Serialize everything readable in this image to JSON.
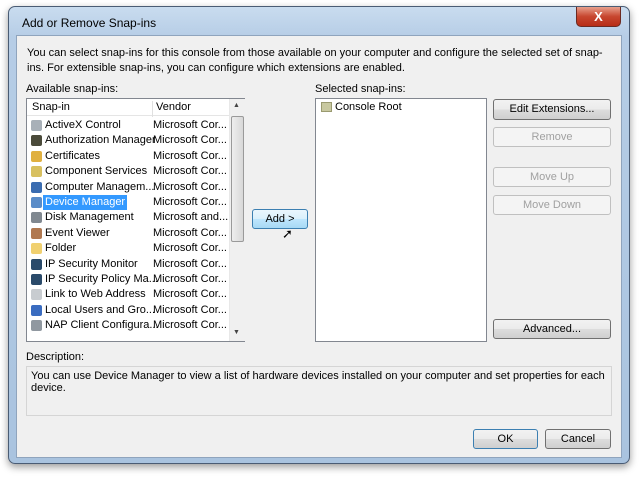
{
  "window": {
    "title": "Add or Remove Snap-ins",
    "close_label": "X"
  },
  "intro": "You can select snap-ins for this console from those available on your computer and configure the selected set of snap-ins. For extensible snap-ins, you can configure which extensions are enabled.",
  "available": {
    "label": "Available snap-ins:",
    "col_snapin": "Snap-in",
    "col_vendor": "Vendor",
    "items": [
      {
        "name": "ActiveX Control",
        "vendor": "Microsoft Cor...",
        "color": "#a8b0b8"
      },
      {
        "name": "Authorization Manager",
        "vendor": "Microsoft Cor...",
        "color": "#4a4a3a"
      },
      {
        "name": "Certificates",
        "vendor": "Microsoft Cor...",
        "color": "#e0b040"
      },
      {
        "name": "Component Services",
        "vendor": "Microsoft Cor...",
        "color": "#d8c060"
      },
      {
        "name": "Computer Managem...",
        "vendor": "Microsoft Cor...",
        "color": "#3a6cb0"
      },
      {
        "name": "Device Manager",
        "vendor": "Microsoft Cor...",
        "color": "#5a8cc8"
      },
      {
        "name": "Disk Management",
        "vendor": "Microsoft and...",
        "color": "#808890"
      },
      {
        "name": "Event Viewer",
        "vendor": "Microsoft Cor...",
        "color": "#b07850"
      },
      {
        "name": "Folder",
        "vendor": "Microsoft Cor...",
        "color": "#f0d070"
      },
      {
        "name": "IP Security Monitor",
        "vendor": "Microsoft Cor...",
        "color": "#2a4a6a"
      },
      {
        "name": "IP Security Policy Ma...",
        "vendor": "Microsoft Cor...",
        "color": "#2a4a6a"
      },
      {
        "name": "Link to Web Address",
        "vendor": "Microsoft Cor...",
        "color": "#c8ccd0"
      },
      {
        "name": "Local Users and Gro...",
        "vendor": "Microsoft Cor...",
        "color": "#3a6cc0"
      },
      {
        "name": "NAP Client Configura...",
        "vendor": "Microsoft Cor...",
        "color": "#9098a0"
      }
    ],
    "selected_index": 5
  },
  "add_button": "Add >",
  "selected": {
    "label": "Selected snap-ins:",
    "items": [
      "Console Root"
    ]
  },
  "buttons": {
    "edit_extensions": "Edit Extensions...",
    "remove": "Remove",
    "move_up": "Move Up",
    "move_down": "Move Down",
    "advanced": "Advanced...",
    "ok": "OK",
    "cancel": "Cancel"
  },
  "description": {
    "label": "Description:",
    "text": "You can use Device Manager to view a list of hardware devices installed on your computer and set properties for each device."
  }
}
